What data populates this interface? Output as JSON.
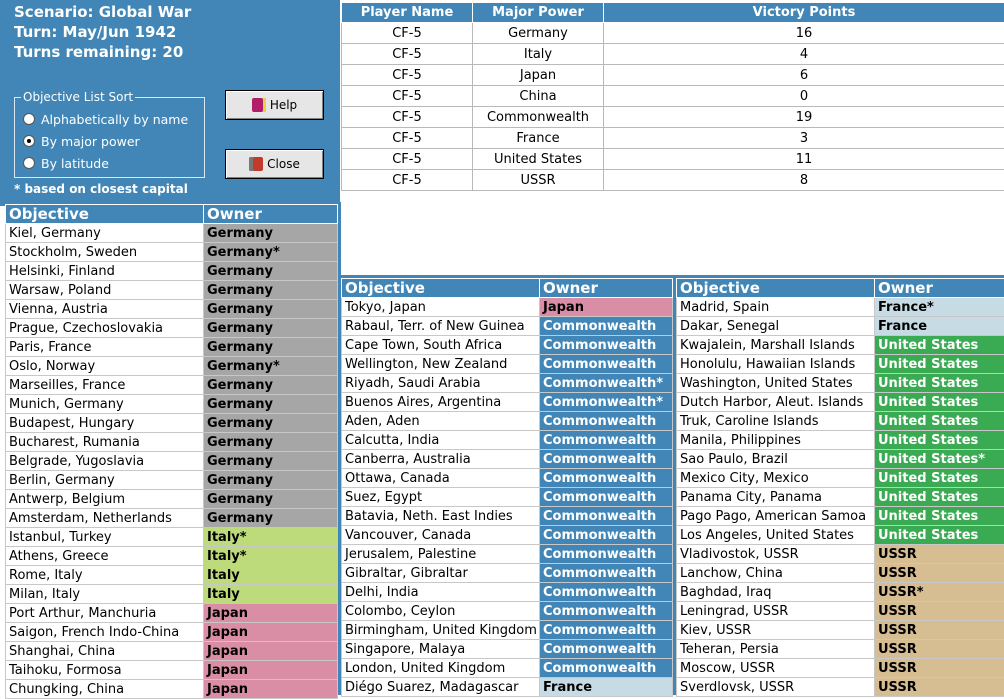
{
  "scenario": {
    "scenario_line": "Scenario: Global War",
    "turn_line": "Turn: May/Jun 1942",
    "turns_line": "Turns remaining: 20"
  },
  "sort": {
    "legend": "Objective List Sort",
    "options": [
      "Alphabetically by name",
      "By major power",
      "By latitude"
    ],
    "selected": "By major power",
    "footnote": "* based on closest capital"
  },
  "buttons": {
    "help": "Help",
    "close": "Close"
  },
  "colors": {
    "panel_blue": "#4186b6",
    "Germany": "#a6a6a6",
    "Italy": "#bddb7b",
    "Japan": "#d98ea6",
    "Commonwealth": "#4186b6",
    "France": "#c7dbe4",
    "United States": "#3aab52",
    "USSR": "#d7bd92"
  },
  "vp_table": {
    "headers": [
      "Player Name",
      "Major Power",
      "Victory Points"
    ],
    "rows": [
      [
        "CF-5",
        "Germany",
        "16"
      ],
      [
        "CF-5",
        "Italy",
        "4"
      ],
      [
        "CF-5",
        "Japan",
        "6"
      ],
      [
        "CF-5",
        "China",
        "0"
      ],
      [
        "CF-5",
        "Commonwealth",
        "19"
      ],
      [
        "CF-5",
        "France",
        "3"
      ],
      [
        "CF-5",
        "United States",
        "11"
      ],
      [
        "CF-5",
        "USSR",
        "8"
      ]
    ]
  },
  "objectives": {
    "headers": [
      "Objective",
      "Owner"
    ],
    "col1": [
      [
        "Kiel, Germany",
        "Germany"
      ],
      [
        "Stockholm, Sweden",
        "Germany*"
      ],
      [
        "Helsinki, Finland",
        "Germany"
      ],
      [
        "Warsaw, Poland",
        "Germany"
      ],
      [
        "Vienna, Austria",
        "Germany"
      ],
      [
        "Prague, Czechoslovakia",
        "Germany"
      ],
      [
        "Paris, France",
        "Germany"
      ],
      [
        "Oslo, Norway",
        "Germany*"
      ],
      [
        "Marseilles, France",
        "Germany"
      ],
      [
        "Munich, Germany",
        "Germany"
      ],
      [
        "Budapest, Hungary",
        "Germany"
      ],
      [
        "Bucharest, Rumania",
        "Germany"
      ],
      [
        "Belgrade, Yugoslavia",
        "Germany"
      ],
      [
        "Berlin, Germany",
        "Germany"
      ],
      [
        "Antwerp, Belgium",
        "Germany"
      ],
      [
        "Amsterdam, Netherlands",
        "Germany"
      ],
      [
        "Istanbul, Turkey",
        "Italy*"
      ],
      [
        "Athens, Greece",
        "Italy*"
      ],
      [
        "Rome, Italy",
        "Italy"
      ],
      [
        "Milan, Italy",
        "Italy"
      ],
      [
        "Port Arthur, Manchuria",
        "Japan"
      ],
      [
        "Saigon, French Indo-China",
        "Japan"
      ],
      [
        "Shanghai, China",
        "Japan"
      ],
      [
        "Taihoku, Formosa",
        "Japan"
      ],
      [
        "Chungking, China",
        "Japan"
      ]
    ],
    "col2": [
      [
        "Tokyo, Japan",
        "Japan"
      ],
      [
        "Rabaul, Terr. of New Guinea",
        "Commonwealth"
      ],
      [
        "Cape Town, South Africa",
        "Commonwealth"
      ],
      [
        "Wellington, New Zealand",
        "Commonwealth"
      ],
      [
        "Riyadh, Saudi Arabia",
        "Commonwealth*"
      ],
      [
        "Buenos Aires, Argentina",
        "Commonwealth*"
      ],
      [
        "Aden, Aden",
        "Commonwealth"
      ],
      [
        "Calcutta, India",
        "Commonwealth"
      ],
      [
        "Canberra, Australia",
        "Commonwealth"
      ],
      [
        "Ottawa, Canada",
        "Commonwealth"
      ],
      [
        "Suez, Egypt",
        "Commonwealth"
      ],
      [
        "Batavia, Neth. East Indies",
        "Commonwealth"
      ],
      [
        "Vancouver, Canada",
        "Commonwealth"
      ],
      [
        "Jerusalem, Palestine",
        "Commonwealth"
      ],
      [
        "Gibraltar, Gibraltar",
        "Commonwealth"
      ],
      [
        "Delhi, India",
        "Commonwealth"
      ],
      [
        "Colombo, Ceylon",
        "Commonwealth"
      ],
      [
        "Birmingham, United Kingdom",
        "Commonwealth"
      ],
      [
        "Singapore, Malaya",
        "Commonwealth"
      ],
      [
        "London, United Kingdom",
        "Commonwealth"
      ],
      [
        "Diégo Suarez, Madagascar",
        "France"
      ]
    ],
    "col3": [
      [
        "Madrid, Spain",
        "France*"
      ],
      [
        "Dakar, Senegal",
        "France"
      ],
      [
        "Kwajalein, Marshall Islands",
        "United States"
      ],
      [
        "Honolulu, Hawaiian Islands",
        "United States"
      ],
      [
        "Washington, United States",
        "United States"
      ],
      [
        "Dutch Harbor, Aleut. Islands",
        "United States"
      ],
      [
        "Truk, Caroline Islands",
        "United States"
      ],
      [
        "Manila, Philippines",
        "United States"
      ],
      [
        "Sao Paulo, Brazil",
        "United States*"
      ],
      [
        "Mexico City, Mexico",
        "United States"
      ],
      [
        "Panama City, Panama",
        "United States"
      ],
      [
        "Pago Pago, American Samoa",
        "United States"
      ],
      [
        "Los Angeles, United States",
        "United States"
      ],
      [
        "Vladivostok, USSR",
        "USSR"
      ],
      [
        "Lanchow, China",
        "USSR"
      ],
      [
        "Baghdad, Iraq",
        "USSR*"
      ],
      [
        "Leningrad, USSR",
        "USSR"
      ],
      [
        "Kiev, USSR",
        "USSR"
      ],
      [
        "Teheran, Persia",
        "USSR"
      ],
      [
        "Moscow, USSR",
        "USSR"
      ],
      [
        "Sverdlovsk, USSR",
        "USSR"
      ]
    ]
  }
}
